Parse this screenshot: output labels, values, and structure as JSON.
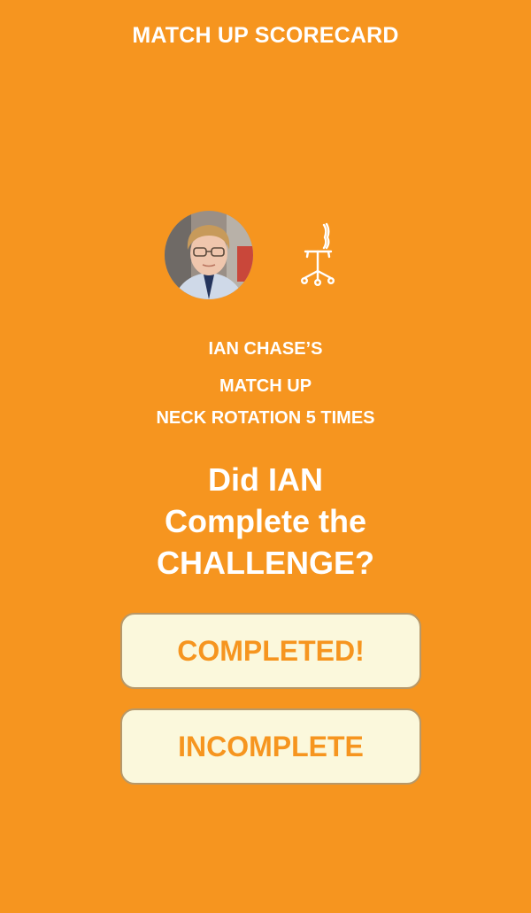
{
  "header": {
    "title": "MATCH UP SCORECARD"
  },
  "player": {
    "avatar_icon": "person-photo",
    "challenge_icon": "office-chair-icon",
    "owner_line": "IAN CHASE’S",
    "type_line": "MATCH UP",
    "task_line": "NECK ROTATION 5 TIMES"
  },
  "question": {
    "line1": "Did IAN",
    "line2": "Complete the",
    "line3": "CHALLENGE?"
  },
  "actions": {
    "completed_label": "COMPLETED!",
    "incomplete_label": "INCOMPLETE"
  },
  "colors": {
    "background": "#f6951f",
    "button_fill": "#fbf8dc",
    "button_text": "#f6951f"
  }
}
